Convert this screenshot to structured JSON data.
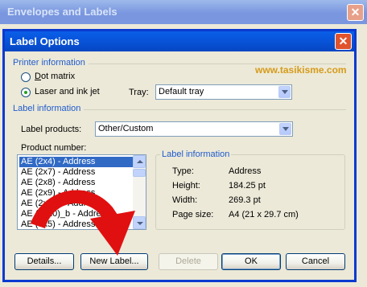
{
  "background_window": {
    "title": "Envelopes and Labels"
  },
  "dialog": {
    "title": "Label Options",
    "printer_information": {
      "heading": "Printer information",
      "dot_matrix_label": "Dot matrix",
      "laser_label": "Laser and ink jet",
      "selected": "laser",
      "tray_label": "Tray:",
      "tray_value": "Default tray"
    },
    "label_information": {
      "heading": "Label information",
      "label_products_label": "Label products:",
      "label_products_value": "Other/Custom",
      "product_number_label": "Product number:",
      "products": [
        "AE (2x4) - Address",
        "AE (2x7) - Address",
        "AE (2x8) - Address",
        "AE (2x9) - Address",
        "AE (2x10) - Address",
        "AE (2x10)_b - Address",
        "AE (3x5) - Address"
      ],
      "selected_product_index": 0
    },
    "details_group": {
      "caption": "Label information",
      "rows": [
        {
          "label": "Type:",
          "value": "Address"
        },
        {
          "label": "Height:",
          "value": "184.25 pt"
        },
        {
          "label": "Width:",
          "value": "269.3 pt"
        },
        {
          "label": "Page size:",
          "value": "A4 (21 x 29.7 cm)"
        }
      ]
    },
    "buttons": {
      "details": "Details...",
      "new_label": "New Label...",
      "delete": "Delete",
      "ok": "OK",
      "cancel": "Cancel"
    }
  },
  "watermark": "www.tasikisme.com",
  "colors": {
    "title_blue": "#0853d8",
    "section_blue": "#1f5bcd",
    "arrow_red": "#e01010",
    "watermark": "#d69b1a"
  }
}
